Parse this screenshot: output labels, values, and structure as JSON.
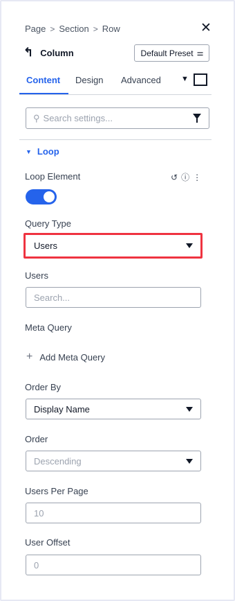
{
  "breadcrumb": {
    "items": [
      "Page",
      "Section",
      "Row"
    ],
    "separator": ">"
  },
  "header": {
    "back_icon": "undo-arrow-icon",
    "title": "Column",
    "preset_label": "Default Preset",
    "preset_icon": "sliders-icon",
    "close_icon": "close-icon"
  },
  "tabs": [
    {
      "label": "Content",
      "active": true
    },
    {
      "label": "Design",
      "active": false
    },
    {
      "label": "Advanced",
      "active": false
    }
  ],
  "search": {
    "placeholder": "Search settings...",
    "icon": "search-icon",
    "filter_icon": "filter-icon"
  },
  "section": {
    "title": "Loop",
    "expanded": true
  },
  "fields": {
    "loop_element": {
      "label": "Loop Element",
      "enabled": true
    },
    "query_type": {
      "label": "Query Type",
      "value": "Users"
    },
    "users": {
      "label": "Users",
      "placeholder": "Search..."
    },
    "meta_query": {
      "label": "Meta Query",
      "add_label": "Add Meta Query"
    },
    "order_by": {
      "label": "Order By",
      "value": "Display Name"
    },
    "order": {
      "label": "Order",
      "value": "Descending"
    },
    "users_per_page": {
      "label": "Users Per Page",
      "placeholder": "10"
    },
    "user_offset": {
      "label": "User Offset",
      "placeholder": "0"
    }
  },
  "colors": {
    "accent": "#2563eb",
    "highlight": "#ef3340"
  }
}
